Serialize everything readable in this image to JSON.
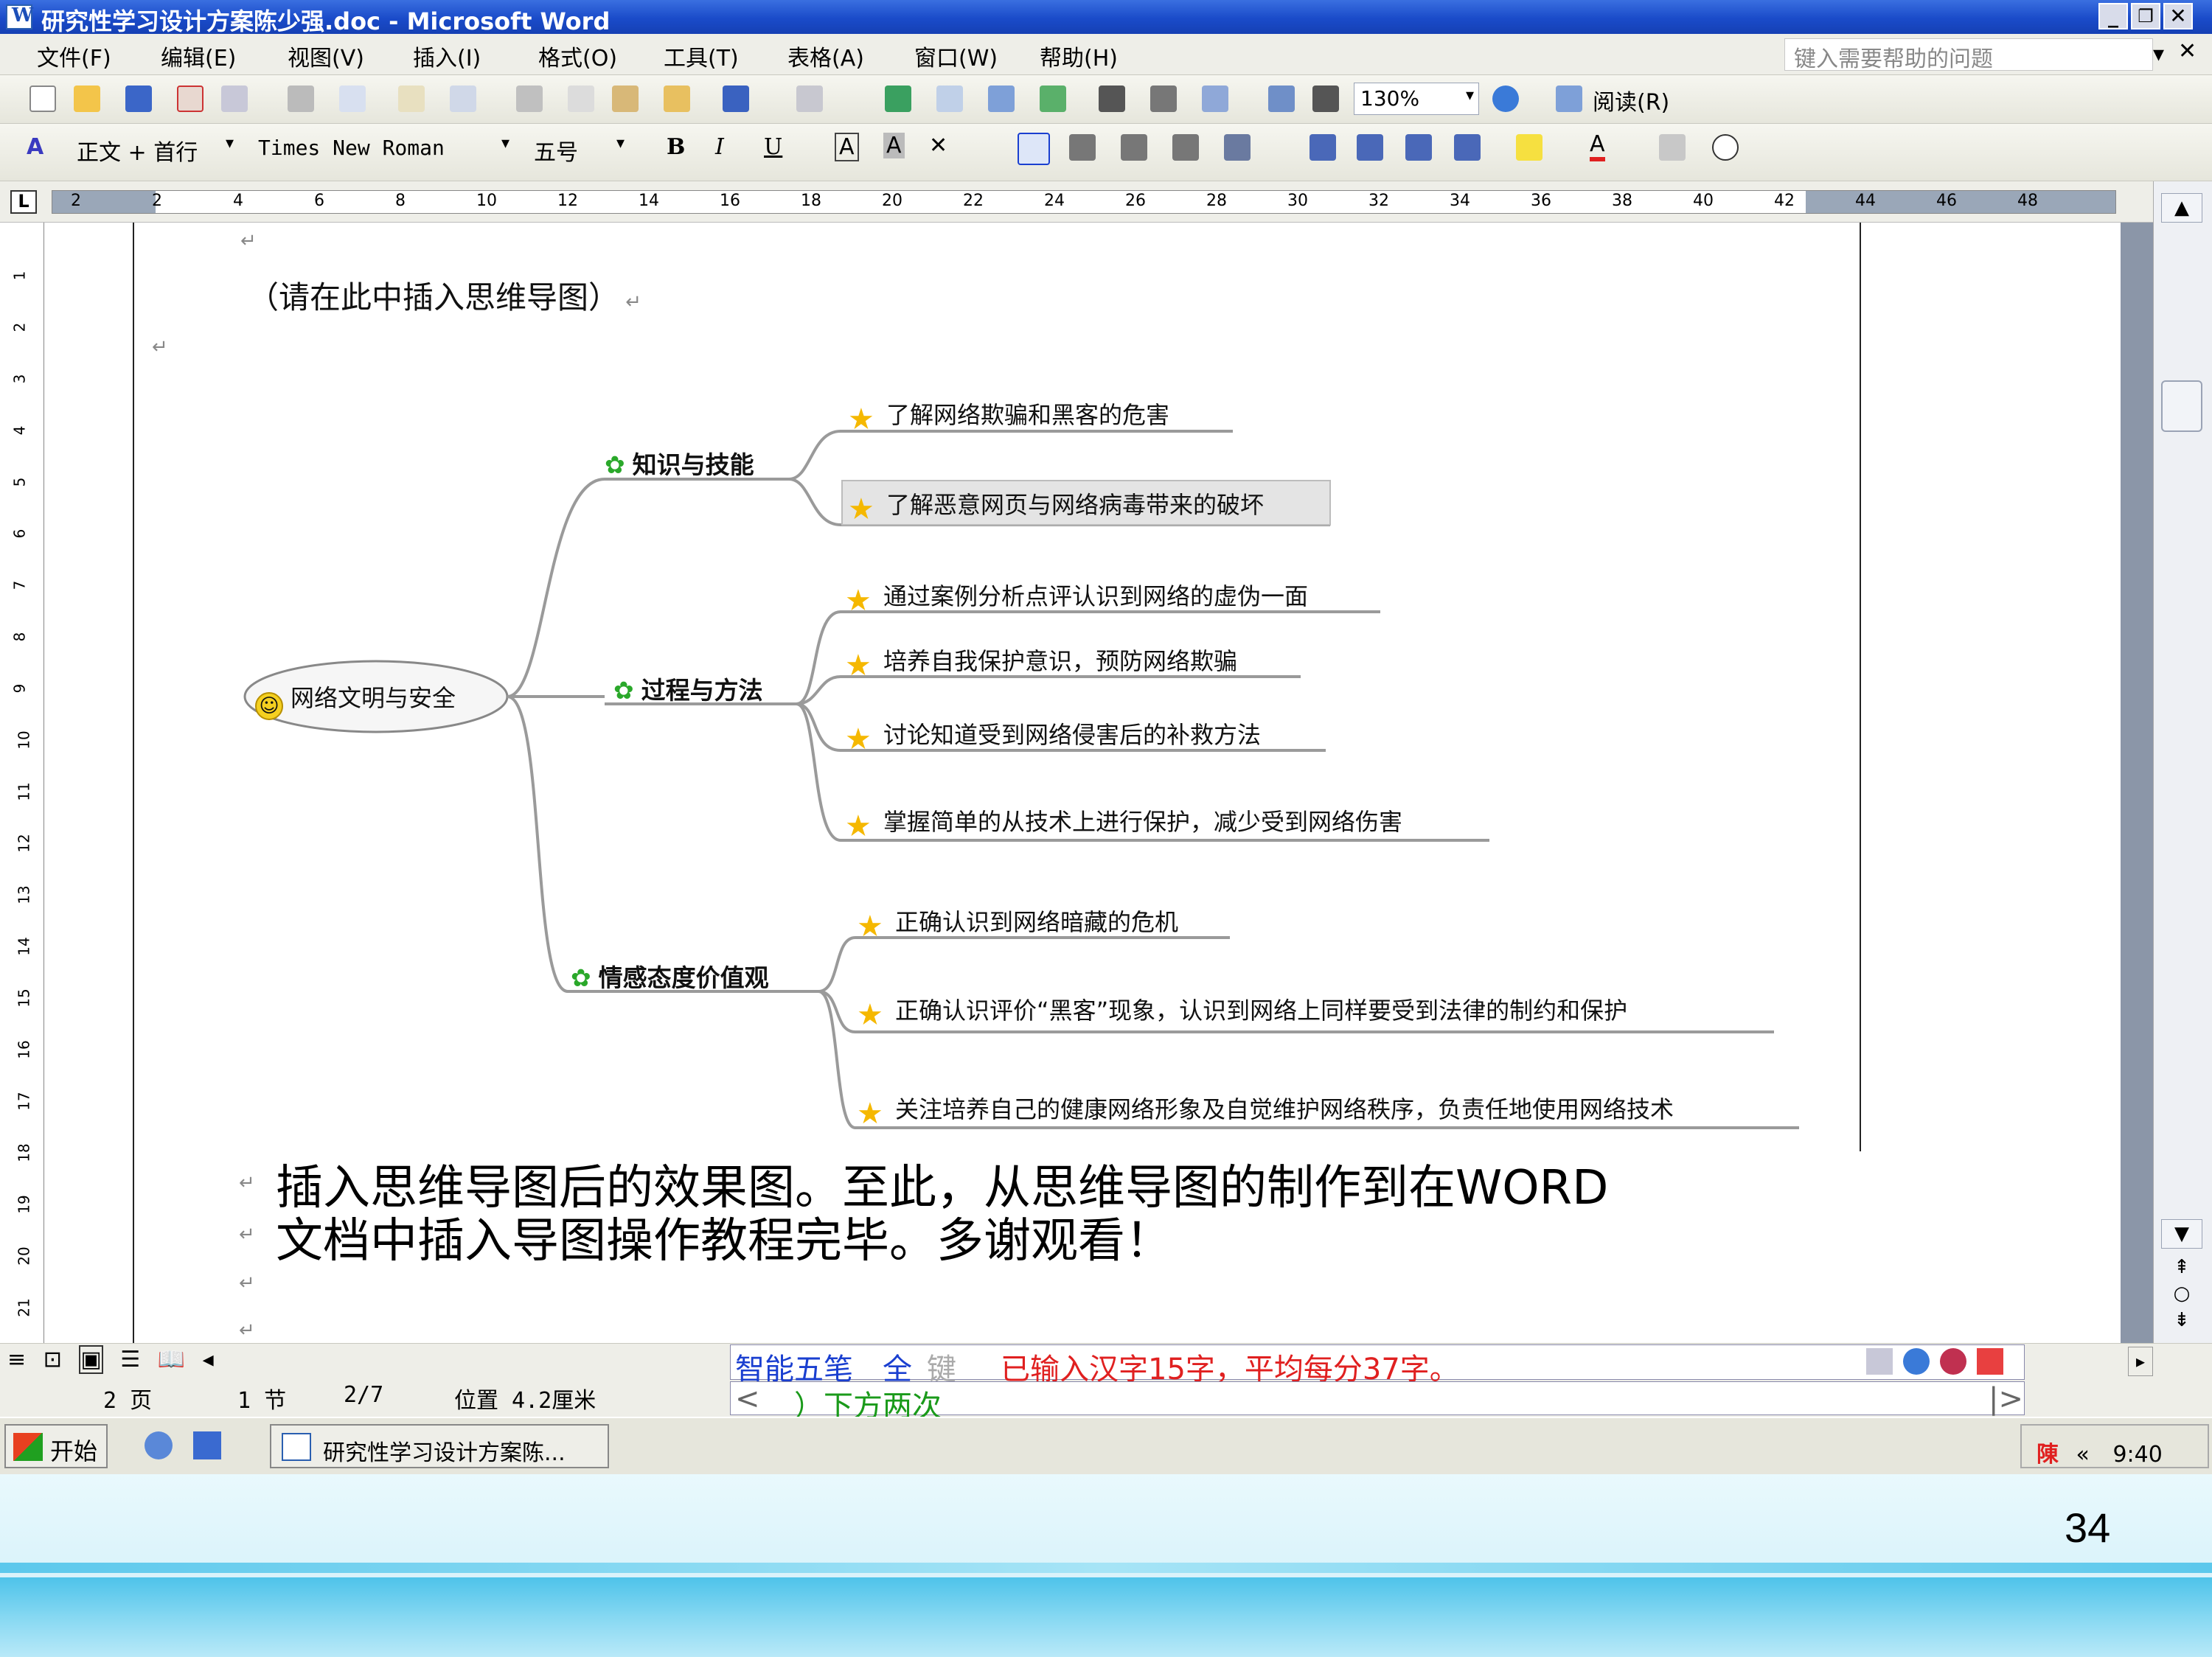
{
  "window": {
    "title": "研究性学习设计方案陈少强.doc - Microsoft Word"
  },
  "menu": {
    "items": [
      "文件(F)",
      "编辑(E)",
      "视图(V)",
      "插入(I)",
      "格式(O)",
      "工具(T)",
      "表格(A)",
      "窗口(W)",
      "帮助(H)"
    ],
    "help_placeholder": "键入需要帮助的问题"
  },
  "toolbar": {
    "zoom": "130%",
    "read_label": "阅读(R)",
    "style": "正文 + 首行",
    "font": "Times New Roman",
    "size": "五号"
  },
  "ruler": {
    "ticks": [
      "2",
      "2",
      "4",
      "6",
      "8",
      "10",
      "12",
      "14",
      "16",
      "18",
      "20",
      "22",
      "24",
      "26",
      "28",
      "30",
      "32",
      "34",
      "36",
      "38",
      "40",
      "42",
      "44",
      "46",
      "48"
    ]
  },
  "document": {
    "placeholder_line": "（请在此中插入思维导图）",
    "mindmap": {
      "root": "网络文明与安全",
      "branches": [
        {
          "label": "知识与技能",
          "items": [
            "了解网络欺骗和黑客的危害",
            "了解恶意网页与网络病毒带来的破坏"
          ]
        },
        {
          "label": "过程与方法",
          "items": [
            "通过案例分析点评认识到网络的虚伪一面",
            "培养自我保护意识，预防网络欺骗",
            "讨论知道受到网络侵害后的补救方法",
            "掌握简单的从技术上进行保护，减少受到网络伤害"
          ]
        },
        {
          "label": "情感态度价值观",
          "items": [
            "正确认识到网络暗藏的危机",
            "正确认识评价“黑客”现象，认识到网络上同样要受到法律的制约和保护",
            "关注培养自己的健康网络形象及自觉维护网络秩序，负责任地使用网络技术"
          ]
        }
      ]
    },
    "caption_line1": "插入思维导图后的效果图。至此，从思维导图的制作到在WORD",
    "caption_line2": "文档中插入导图操作教程完毕。多谢观看！"
  },
  "ime": {
    "mode": "智能五笔",
    "full": "全",
    "key": "键",
    "stats": "已输入汉字15字，平均每分37字。",
    "candidate_left": "<",
    "candidate": "）下方两次",
    "candidate_right": "|>"
  },
  "status": {
    "page": "2 页",
    "section": "1 节",
    "pages": "2/7",
    "position": "位置 4.2厘米"
  },
  "taskbar": {
    "start": "开始",
    "task": "研究性学习设计方案陈...",
    "ime_indicator": "陳",
    "clock": "9:40"
  },
  "slide": {
    "number": "34"
  },
  "colors": {
    "titlebar": "#1a4bc9",
    "ime_mode": "#1a3fd0",
    "ime_stats": "#e02020",
    "ime_candidate": "#1a9a1a",
    "branch_icon": "#2aa82a",
    "star": "#f5b800"
  }
}
